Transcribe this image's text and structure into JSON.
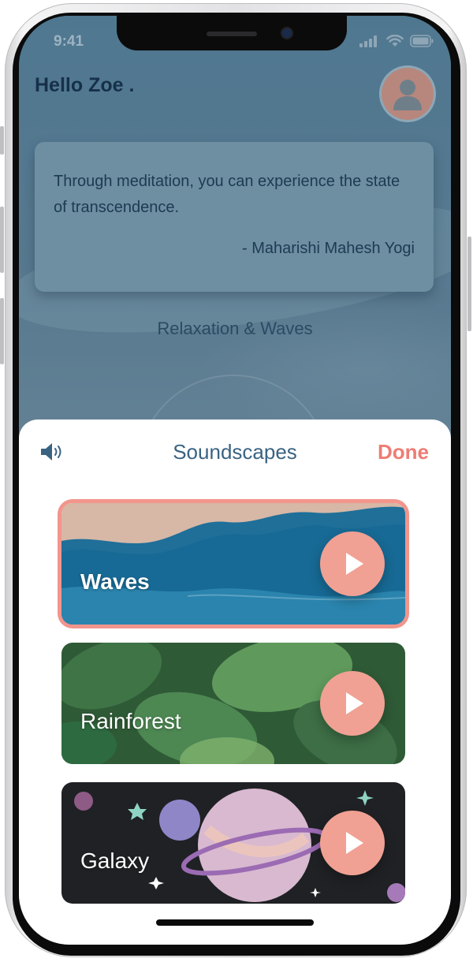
{
  "status": {
    "time": "9:41"
  },
  "header": {
    "greeting": "Hello Zoe .",
    "avatar_icon": "user-avatar-icon"
  },
  "quote": {
    "text": "Through meditation, you can experience the state of transcendence.",
    "author": "-  Maharishi Mahesh Yogi"
  },
  "session": {
    "title": "Relaxation & Waves"
  },
  "sheet": {
    "title": "Soundscapes",
    "done_label": "Done",
    "volume_icon": "speaker-volume-icon",
    "cards": [
      {
        "label": "Waves",
        "selected": true,
        "theme": "waves"
      },
      {
        "label": "Rainforest",
        "selected": false,
        "theme": "rainforest"
      },
      {
        "label": "Galaxy",
        "selected": false,
        "theme": "galaxy"
      }
    ]
  },
  "colors": {
    "accent": "#ee7c74",
    "play_button": "#f0a193",
    "title_blue": "#3a6382",
    "greeting": "#163049"
  }
}
